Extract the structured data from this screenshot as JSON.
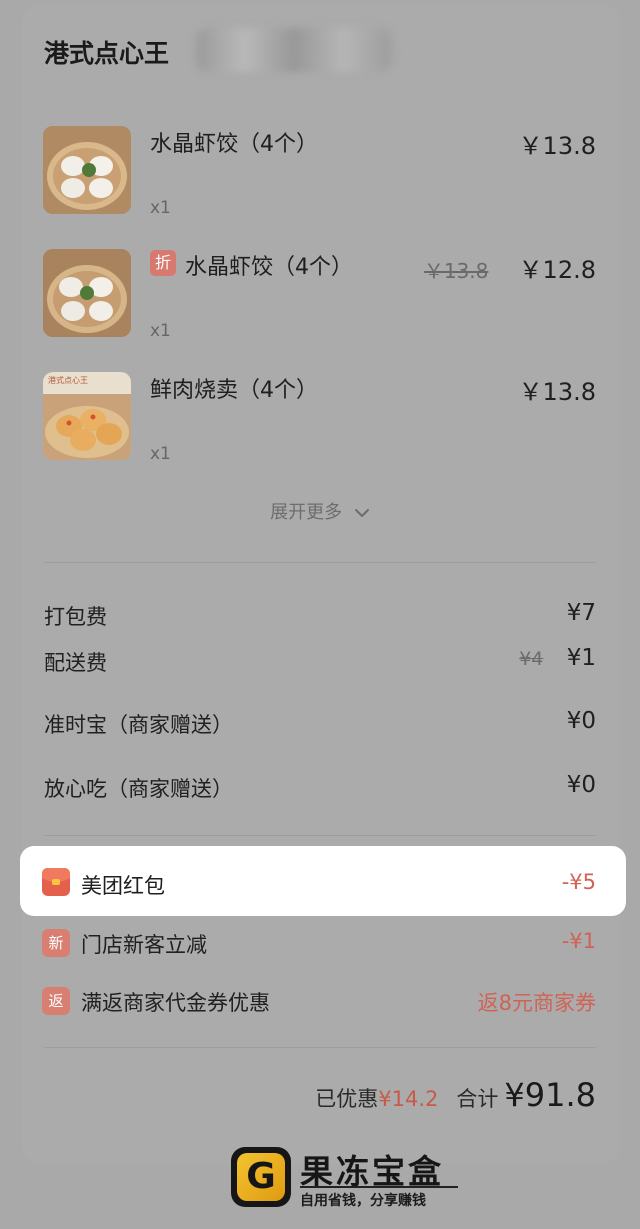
{
  "shop": {
    "name": "港式点心王"
  },
  "items": [
    {
      "name": "水晶虾饺（4个）",
      "qty": "x1",
      "price": "￥13.8",
      "original_price": "",
      "tag": ""
    },
    {
      "name": "水晶虾饺（4个）",
      "qty": "x1",
      "price": "￥12.8",
      "original_price": "￥13.8",
      "tag": "折"
    },
    {
      "name": "鲜肉烧卖（4个）",
      "qty": "x1",
      "price": "￥13.8",
      "original_price": "",
      "tag": "",
      "image_caption": "港式点心王"
    }
  ],
  "expand_label": "展开更多",
  "fees": [
    {
      "label": "打包费",
      "value": "¥7",
      "original": ""
    },
    {
      "label": "配送费",
      "value": "¥1",
      "original": "¥4"
    },
    {
      "label": "准时宝（商家赠送）",
      "value": "¥0",
      "original": ""
    },
    {
      "label": "放心吃（商家赠送）",
      "value": "¥0",
      "original": ""
    }
  ],
  "discounts": [
    {
      "icon": "red-packet-icon",
      "icon_text": "",
      "label": "美团红包",
      "value": "-¥5"
    },
    {
      "icon": "new-customer-icon",
      "icon_text": "新",
      "label": "门店新客立减",
      "value": "-¥1"
    },
    {
      "icon": "cashback-icon",
      "icon_text": "返",
      "label": "满返商家代金券优惠",
      "value": "返8元商家券"
    }
  ],
  "summary": {
    "saved_label": "已优惠",
    "saved_value": "¥14.2",
    "total_label": "合计",
    "total_value": "¥91.8"
  },
  "watermark": {
    "title": "果冻宝盒",
    "subtitle": "自用省钱，分享赚钱",
    "logo_letter": "G"
  },
  "colors": {
    "accent_red": "#d06353",
    "highlight": "#ffffff"
  }
}
